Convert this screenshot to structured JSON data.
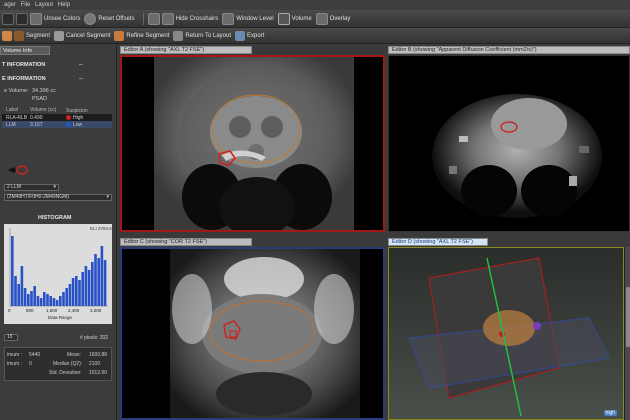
{
  "menubar": {
    "items": [
      "ager",
      "File",
      "Layout",
      "Help"
    ]
  },
  "toolbar": {
    "unsee_colors": "Unsee Colors",
    "reset_offsets": "Reset Offsets",
    "hide_crosshairs": "Hide Crosshairs",
    "window_level": "Window Level",
    "volume": "Volume",
    "overlay": "Overlay"
  },
  "toolbar2": {
    "segment": "Segment",
    "cancel_segment": "Cancel Segment",
    "refine_segment": "Refine Segment",
    "return_to_layout": "Return To Layout",
    "export": "Export"
  },
  "left_panel": {
    "tab": "Volume Info",
    "section1": "T INFORMATION",
    "section2": "E INFORMATION",
    "volume_label": "e Volume:",
    "volume_value": "34.396 cc",
    "psad_label": "PSAD",
    "table_headers": [
      "Label",
      "Volume (cc)",
      "Suspicion"
    ],
    "rows": [
      {
        "label": "RLA-RLB",
        "volume": "0.490",
        "suspicion": "High",
        "color": "#cc2222"
      },
      {
        "label": "LLM",
        "volume": "3.157",
        "suspicion": "Low",
        "color": "#2255cc"
      }
    ],
    "select_value": "2 LLM",
    "series_value": "(2M49HT/F0H0-2M49NGM)",
    "histogram_title": "HISTOGRAM",
    "histogram_max": "ELI 2784.5",
    "histogram_ticks": [
      "0",
      "800",
      "1,600",
      "2,400",
      "3,200"
    ],
    "data_range": "Data Range",
    "num_field": "15",
    "pixels": "# pixels: 202",
    "stats": {
      "min_label": "imum :",
      "min_value": "5440",
      "max_label": "imum :",
      "max_value": "0",
      "mean_label": "Mean:",
      "mean_value": "1600.88",
      "median_label": "Median (Q2):",
      "median_value": "2100",
      "std_label": "Std. Deviation:",
      "std_value": "1012.00"
    }
  },
  "editors": {
    "a": {
      "tab": "Editor A (showing \"AXL T2 FSE\")"
    },
    "b": {
      "tab": "Editor B (showing \"Apparent Diffusion Coefficient (mm2/s)\")"
    },
    "c": {
      "tab": "Editor C (showing \"COR T2 FSE\")"
    },
    "d": {
      "tab": "Editor D (showing \"AXL T2 FSE\")",
      "badge": "high"
    }
  },
  "colors": {
    "accent_red": "#b01818",
    "accent_blue": "#2a3c7a",
    "selected_tab": "#d5e4f5"
  }
}
